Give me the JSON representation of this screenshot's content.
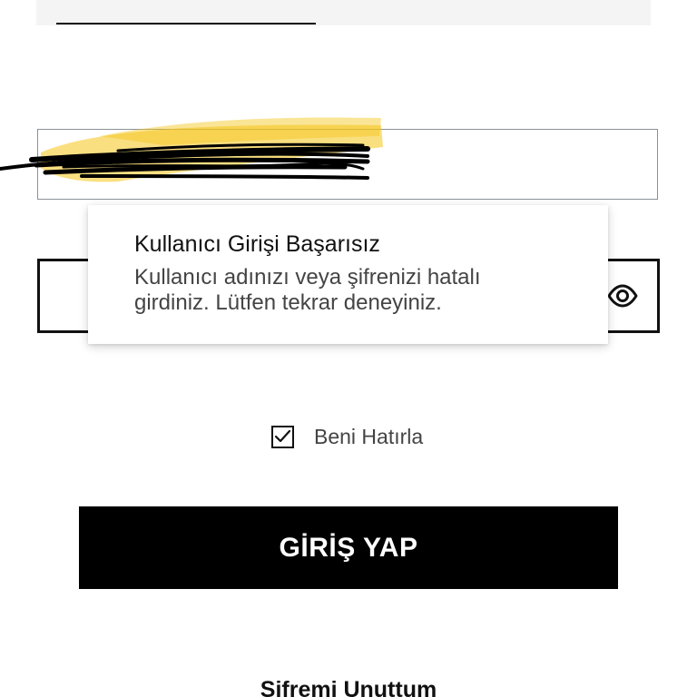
{
  "error_dialog": {
    "title": "Kullanıcı Girişi Başarısız",
    "message": "Kullanıcı adınızı veya şifrenizi hatalı girdiniz. Lütfen tekrar deneyiniz."
  },
  "remember_me": {
    "label": "Beni Hatırla",
    "checked": true
  },
  "login_button": {
    "label": "GİRİŞ YAP"
  },
  "forgot_password": {
    "label": "Şifremi Unuttum"
  },
  "icons": {
    "password_toggle": "eye-icon",
    "checkbox_mark": "checkmark-icon"
  },
  "colors": {
    "primary_button": "#000000",
    "redaction_highlight": "#f5c518",
    "field_border_active": "#111111",
    "field_border_inactive": "#8a9196"
  }
}
